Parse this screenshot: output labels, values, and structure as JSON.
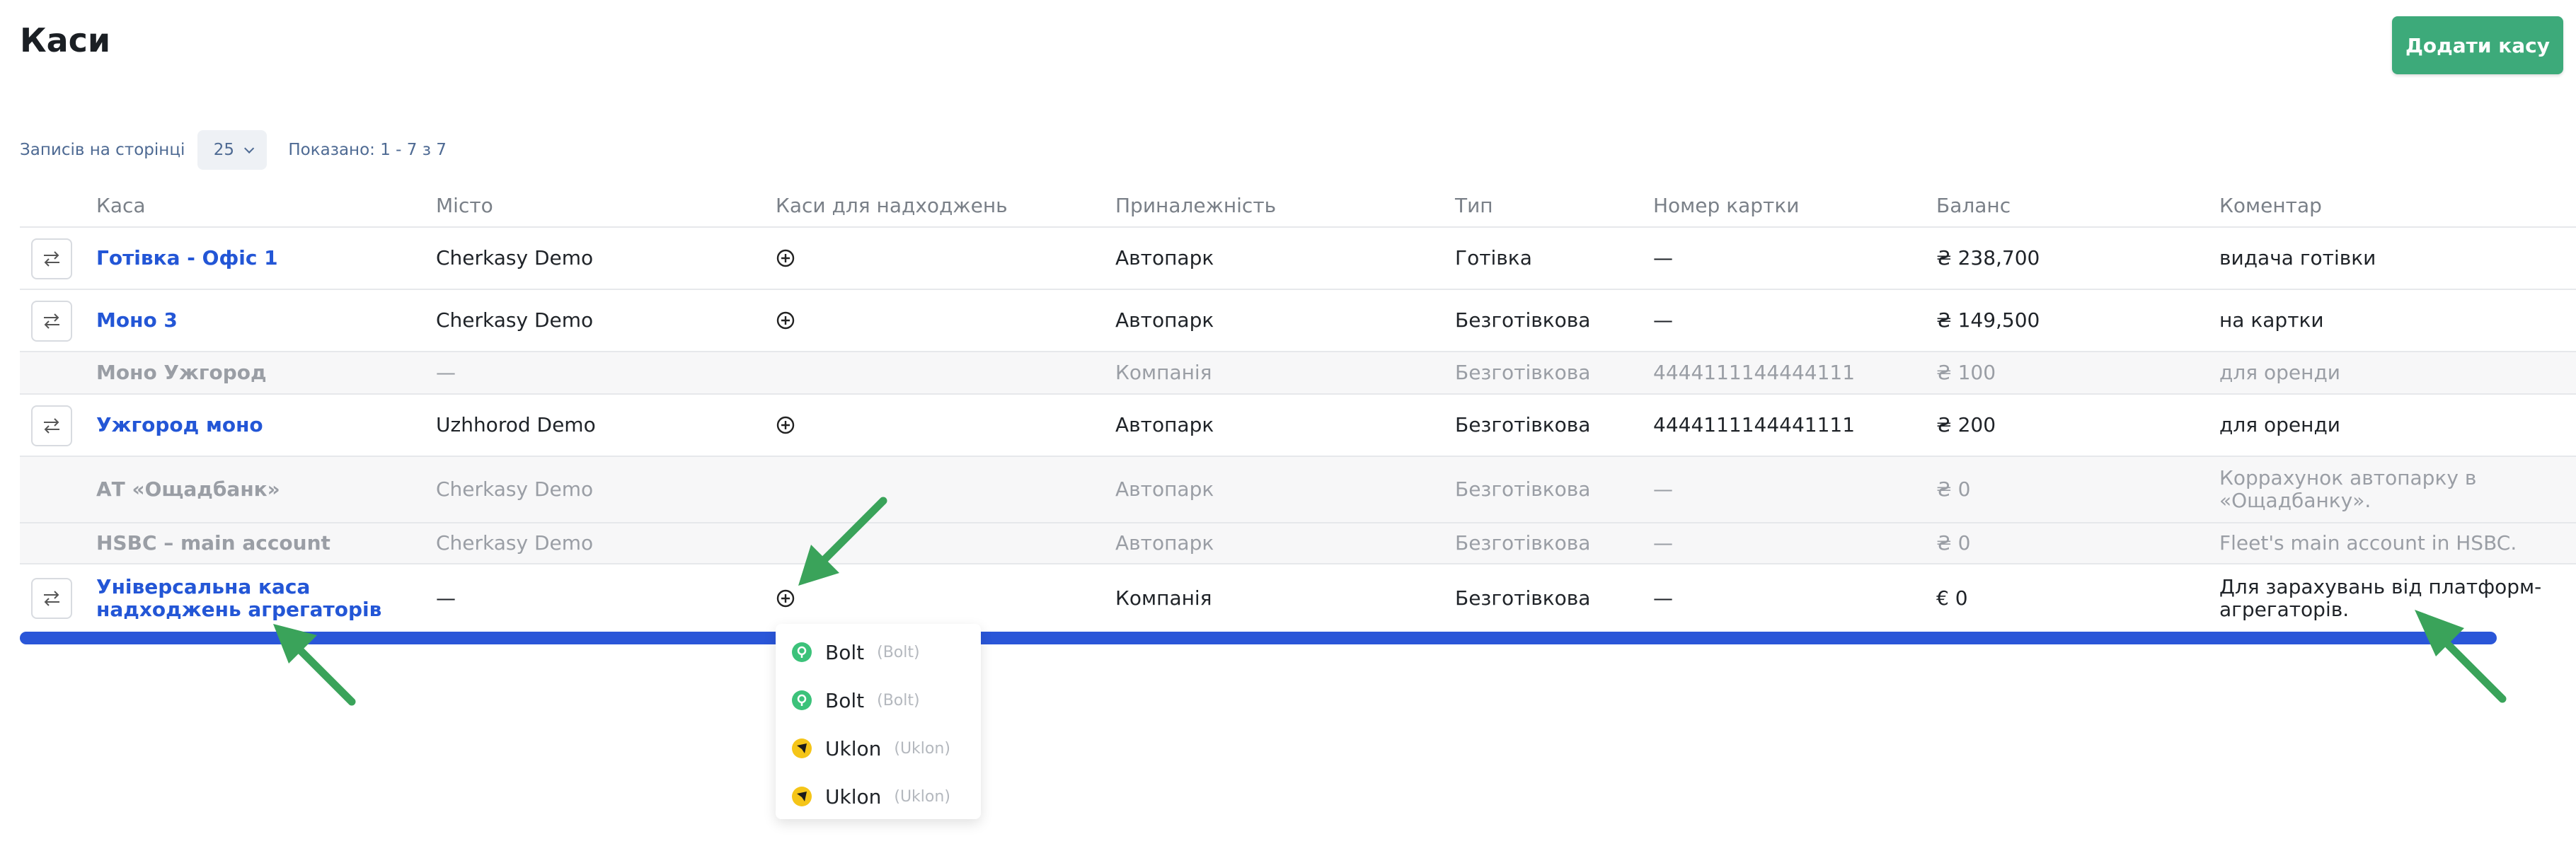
{
  "page": {
    "title": "Каси",
    "add_button": "Додати касу"
  },
  "pager": {
    "per_page_label": "Записів на сторінці",
    "per_page_value": "25",
    "shown": "Показано: 1 - 7 з 7"
  },
  "table": {
    "columns": [
      "Каса",
      "Місто",
      "Каси для надходжень",
      "Приналежність",
      "Тип",
      "Номер картки",
      "Баланс",
      "Коментар"
    ],
    "rows": [
      {
        "name": "Готівка - Офіс 1",
        "city": "Cherkasy Demo",
        "income": true,
        "owner": "Автопарк",
        "type": "Готівка",
        "card": "—",
        "balance": "₴ 238,700",
        "comment": "видача готівки",
        "active": true
      },
      {
        "name": "Моно 3",
        "city": "Cherkasy Demo",
        "income": true,
        "owner": "Автопарк",
        "type": "Безготівкова",
        "card": "—",
        "balance": "₴ 149,500",
        "comment": "на картки",
        "active": true
      },
      {
        "name": "Моно Ужгород",
        "city": "—",
        "income": false,
        "owner": "Компанія",
        "type": "Безготівкова",
        "card": "4444111144444111",
        "balance": "₴ 100",
        "comment": "для оренди",
        "active": false
      },
      {
        "name": "Ужгород моно",
        "city": "Uzhhorod Demo",
        "income": true,
        "owner": "Автопарк",
        "type": "Безготівкова",
        "card": "4444111144441111",
        "balance": "₴ 200",
        "comment": "для оренди",
        "active": true
      },
      {
        "name": "АТ «Ощадбанк»",
        "city": "Cherkasy Demo",
        "income": false,
        "owner": "Автопарк",
        "type": "Безготівкова",
        "card": "—",
        "balance": "₴ 0",
        "comment_line1": "Коррахунок автопарку в",
        "comment_line2": "«Ощадбанку».",
        "active": false
      },
      {
        "name": "HSBC – main account",
        "city": "Cherkasy Demo",
        "income": false,
        "owner": "Автопарк",
        "type": "Безготівкова",
        "card": "—",
        "balance": "₴ 0",
        "comment": "Fleet's main account in HSBC.",
        "active": false
      },
      {
        "name_line1": "Універсальна каса",
        "name_line2": "надходжень агрегаторів",
        "city": "—",
        "income": true,
        "owner": "Компанія",
        "type": "Безготівкова",
        "card": "—",
        "balance": "€ 0",
        "comment_line1": "Для зарахувань від платформ-",
        "comment_line2": "агрегаторів.",
        "active": true
      }
    ]
  },
  "dropdown": {
    "items": [
      {
        "label": "Bolt",
        "sub": "(Bolt)",
        "icon": "bolt-icon",
        "color": "#3cc27a"
      },
      {
        "label": "Bolt",
        "sub": "(Bolt)",
        "icon": "bolt-icon",
        "color": "#3cc27a"
      },
      {
        "label": "Uklon",
        "sub": "(Uklon)",
        "icon": "uklon-icon",
        "color": "#f5c518"
      },
      {
        "label": "Uklon",
        "sub": "(Uklon)",
        "icon": "uklon-icon",
        "color": "#f5c518"
      }
    ]
  },
  "colors": {
    "accent": "#3daa7a",
    "link": "#2356d6",
    "scrollbar": "#2a56d8",
    "arrow": "#3aa35a"
  }
}
